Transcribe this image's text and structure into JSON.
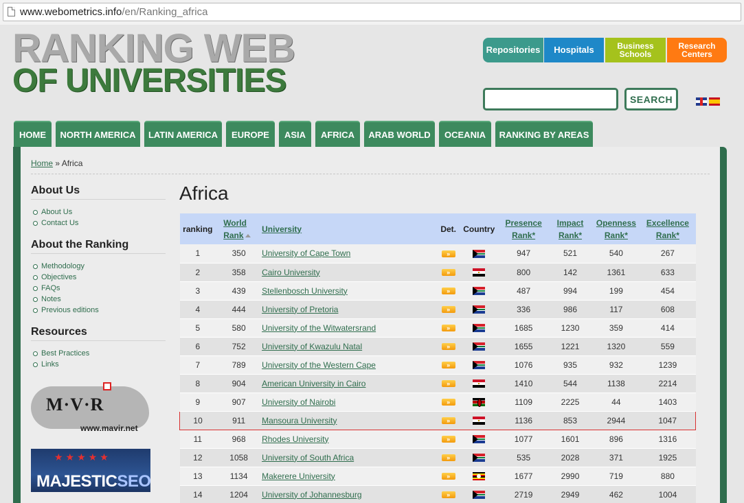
{
  "browser": {
    "url_host": "www.webometrics.info",
    "url_path": "/en/Ranking_africa"
  },
  "logo": {
    "line1": "RANKING WEB",
    "line2": "OF UNIVERSITIES"
  },
  "top_buttons": {
    "repositories": "Repositories",
    "hospitals": "Hospitals",
    "business": "Business Schools",
    "research": "Research Centers"
  },
  "search": {
    "button": "SEARCH",
    "placeholder": ""
  },
  "nav": [
    "HOME",
    "NORTH AMERICA",
    "LATIN AMERICA",
    "EUROPE",
    "ASIA",
    "AFRICA",
    "ARAB WORLD",
    "OCEANIA",
    "RANKING BY AREAS"
  ],
  "breadcrumb": {
    "home": "Home",
    "sep": "»",
    "current": "Africa"
  },
  "sidebar": {
    "about_us": {
      "title": "About Us",
      "items": [
        "About Us",
        "Contact Us"
      ]
    },
    "about_ranking": {
      "title": "About the Ranking",
      "items": [
        "Methodology",
        "Objectives",
        "FAQs",
        "Notes",
        "Previous editions"
      ]
    },
    "resources": {
      "title": "Resources",
      "items": [
        "Best Practices",
        "Links"
      ]
    },
    "mavir": {
      "text": "M·V·R",
      "url": "www.mavir.net"
    },
    "majestic": {
      "text1": "MAJESTIC",
      "text2": "SEO"
    }
  },
  "main": {
    "title": "Africa"
  },
  "table": {
    "headers": {
      "ranking": "ranking",
      "world_rank_1": "World",
      "world_rank_2": "Rank",
      "university": "University",
      "det": "Det.",
      "country": "Country",
      "presence_1": "Presence",
      "presence_2": "Rank*",
      "impact_1": "Impact",
      "impact_2": "Rank*",
      "openness_1": "Openness",
      "openness_2": "Rank*",
      "excellence_1": "Excellence",
      "excellence_2": "Rank*"
    },
    "det_label": "»",
    "rows": [
      {
        "ranking": "1",
        "world": "350",
        "name": "University of Cape Town",
        "flag": "za",
        "presence": "947",
        "impact": "521",
        "openness": "540",
        "excellence": "267"
      },
      {
        "ranking": "2",
        "world": "358",
        "name": "Cairo University",
        "flag": "eg",
        "presence": "800",
        "impact": "142",
        "openness": "1361",
        "excellence": "633"
      },
      {
        "ranking": "3",
        "world": "439",
        "name": "Stellenbosch University",
        "flag": "za",
        "presence": "487",
        "impact": "994",
        "openness": "199",
        "excellence": "454"
      },
      {
        "ranking": "4",
        "world": "444",
        "name": "University of Pretoria",
        "flag": "za",
        "presence": "336",
        "impact": "986",
        "openness": "117",
        "excellence": "608"
      },
      {
        "ranking": "5",
        "world": "580",
        "name": "University of the Witwatersrand",
        "flag": "za",
        "presence": "1685",
        "impact": "1230",
        "openness": "359",
        "excellence": "414"
      },
      {
        "ranking": "6",
        "world": "752",
        "name": "University of Kwazulu Natal",
        "flag": "za",
        "presence": "1655",
        "impact": "1221",
        "openness": "1320",
        "excellence": "559"
      },
      {
        "ranking": "7",
        "world": "789",
        "name": "University of the Western Cape",
        "flag": "za",
        "presence": "1076",
        "impact": "935",
        "openness": "932",
        "excellence": "1239"
      },
      {
        "ranking": "8",
        "world": "904",
        "name": "American University in Cairo",
        "flag": "eg",
        "presence": "1410",
        "impact": "544",
        "openness": "1138",
        "excellence": "2214"
      },
      {
        "ranking": "9",
        "world": "907",
        "name": "University of Nairobi",
        "flag": "ke",
        "presence": "1109",
        "impact": "2225",
        "openness": "44",
        "excellence": "1403"
      },
      {
        "ranking": "10",
        "world": "911",
        "name": "Mansoura University",
        "flag": "eg",
        "presence": "1136",
        "impact": "853",
        "openness": "2944",
        "excellence": "1047",
        "highlight": true
      },
      {
        "ranking": "11",
        "world": "968",
        "name": "Rhodes University",
        "flag": "za",
        "presence": "1077",
        "impact": "1601",
        "openness": "896",
        "excellence": "1316"
      },
      {
        "ranking": "12",
        "world": "1058",
        "name": "University of South Africa",
        "flag": "za",
        "presence": "535",
        "impact": "2028",
        "openness": "371",
        "excellence": "1925"
      },
      {
        "ranking": "13",
        "world": "1134",
        "name": "Makerere University",
        "flag": "ug",
        "presence": "1677",
        "impact": "2990",
        "openness": "719",
        "excellence": "880"
      },
      {
        "ranking": "14",
        "world": "1204",
        "name": "University of Johannesburg",
        "flag": "za",
        "presence": "2719",
        "impact": "2949",
        "openness": "462",
        "excellence": "1004"
      }
    ]
  }
}
